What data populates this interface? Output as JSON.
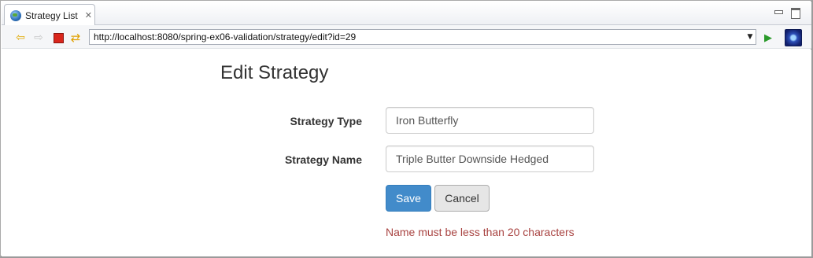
{
  "tab": {
    "title": "Strategy List",
    "close_glyph": "✕",
    "icon": "globe-icon"
  },
  "toolbar": {
    "back_glyph": "⇦",
    "forward_glyph": "⇨",
    "refresh_glyph": "⇄",
    "go_glyph": "▶",
    "url": "http://localhost:8080/spring-ex06-validation/strategy/edit?id=29",
    "url_dropdown_glyph": "▼"
  },
  "page": {
    "title": "Edit Strategy",
    "form": {
      "strategy_type_label": "Strategy Type",
      "strategy_type_value": "Iron Butterfly",
      "strategy_name_label": "Strategy Name",
      "strategy_name_value": "Triple Butter Downside Hedged",
      "save_label": "Save",
      "cancel_label": "Cancel",
      "error_message": "Name must be less than 20 characters"
    }
  },
  "colors": {
    "primary_button": "#428bca",
    "error_text": "#a94442",
    "stop_icon": "#d9261c"
  }
}
